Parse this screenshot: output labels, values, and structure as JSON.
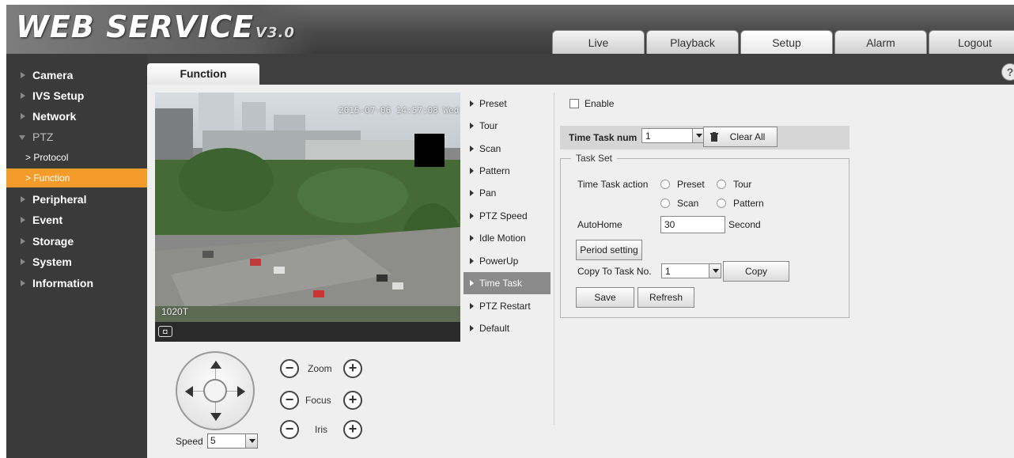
{
  "header": {
    "logo_text": "WEB SERVICE",
    "logo_version": "V3.0",
    "tabs": [
      {
        "label": "Live"
      },
      {
        "label": "Playback"
      },
      {
        "label": "Setup"
      },
      {
        "label": "Alarm"
      },
      {
        "label": "Logout"
      }
    ],
    "active_tab": "Setup"
  },
  "sidebar": {
    "items": [
      {
        "label": "Camera"
      },
      {
        "label": "IVS Setup"
      },
      {
        "label": "Network"
      },
      {
        "label": "PTZ"
      },
      {
        "label": "Peripheral"
      },
      {
        "label": "Event"
      },
      {
        "label": "Storage"
      },
      {
        "label": "System"
      },
      {
        "label": "Information"
      }
    ],
    "ptz_subitems": [
      {
        "label": "> Protocol"
      },
      {
        "label": "> Function"
      }
    ],
    "accent_color": "#f39c2a"
  },
  "page": {
    "tab_title": "Function",
    "help_icon": "?"
  },
  "video": {
    "osd_timestamp": "2015-07-06 14:57:08 Wed",
    "osd_channel": "1020T",
    "snapshot_icon": "camera-icon"
  },
  "ptz": {
    "zoom_label": "Zoom",
    "focus_label": "Focus",
    "iris_label": "Iris",
    "minus": "−",
    "plus": "+",
    "speed_label": "Speed",
    "speed_value": "5"
  },
  "function_menu": {
    "items": [
      {
        "label": "Preset"
      },
      {
        "label": "Tour"
      },
      {
        "label": "Scan"
      },
      {
        "label": "Pattern"
      },
      {
        "label": "Pan"
      },
      {
        "label": "PTZ Speed"
      },
      {
        "label": "Idle Motion"
      },
      {
        "label": "PowerUp"
      },
      {
        "label": "Time Task"
      },
      {
        "label": "PTZ Restart"
      },
      {
        "label": "Default"
      }
    ],
    "active": "Time Task"
  },
  "form": {
    "enable_label": "Enable",
    "enable_checked": false,
    "task_num_label": "Time Task num",
    "task_num_value": "1",
    "clear_all_label": "Clear All",
    "task_set_title": "Task Set",
    "action_label": "Time Task action",
    "actions": [
      {
        "label": "Preset"
      },
      {
        "label": "Tour"
      },
      {
        "label": "Scan"
      },
      {
        "label": "Pattern"
      }
    ],
    "autohome_label": "AutoHome",
    "autohome_value": "30",
    "autohome_unit": "Second",
    "period_setting_label": "Period setting",
    "copy_to_label": "Copy To Task No.",
    "copy_to_value": "1",
    "copy_label": "Copy",
    "save_label": "Save",
    "refresh_label": "Refresh"
  }
}
